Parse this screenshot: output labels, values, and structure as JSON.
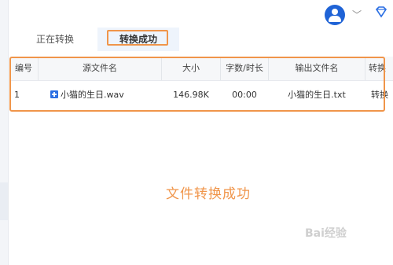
{
  "tabs": [
    {
      "label": "正在转换"
    },
    {
      "label": "转换成功"
    }
  ],
  "table": {
    "headers": [
      "编号",
      "源文件名",
      "大小",
      "字数/时长",
      "输出文件名",
      "转换"
    ],
    "rows": [
      {
        "index": "1",
        "source": "小猫的生日.wav",
        "size": "146.98K",
        "duration": "00:00",
        "output": "小猫的生日.txt",
        "status": "转换"
      }
    ]
  },
  "message": "文件转换成功",
  "watermark": "Bai经验",
  "colors": {
    "accent": "#f0954a",
    "brand": "#1f63d6"
  }
}
